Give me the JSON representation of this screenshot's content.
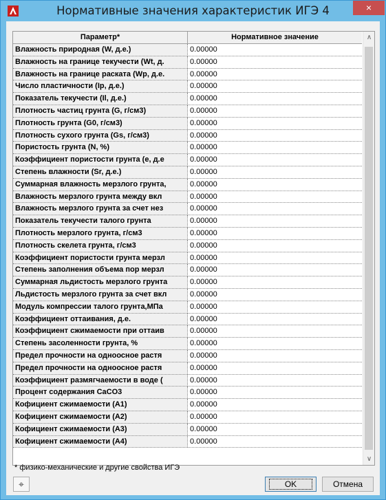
{
  "window": {
    "title": "Нормативные значения характеристик ИГЭ 4",
    "close_glyph": "×"
  },
  "grid": {
    "columns": [
      "Параметр*",
      "Нормативное значение"
    ],
    "rows": [
      {
        "param": "Влажность природная (W, д.е.)",
        "value": "0.00000"
      },
      {
        "param": "Влажность на границе текучести (Wt, д.",
        "value": "0.00000"
      },
      {
        "param": "Влажность на границе раската (Wp, д.е.",
        "value": "0.00000"
      },
      {
        "param": "Число пластичности (Ip, д.е.)",
        "value": "0.00000"
      },
      {
        "param": "Показатель текучести (Il, д.е.)",
        "value": "0.00000"
      },
      {
        "param": "Плотность частиц грунта (G, г/см3)",
        "value": "0.00000"
      },
      {
        "param": "Плотность грунта (G0, г/см3)",
        "value": "0.00000"
      },
      {
        "param": "Плотность сухого грунта (Gs, г/см3)",
        "value": "0.00000"
      },
      {
        "param": "Пористость грунта (N, %)",
        "value": "0.00000"
      },
      {
        "param": "Коэффициент пористости грунта (e, д.е",
        "value": "0.00000"
      },
      {
        "param": "Степень влажности (Sr, д.е.)",
        "value": "0.00000"
      },
      {
        "param": "Суммарная влажность мерзлого грунта,",
        "value": "0.00000"
      },
      {
        "param": "Влажность мерзлого грунта между вкл",
        "value": "0.00000"
      },
      {
        "param": "Влажность мерзлого грунта за счет нез",
        "value": "0.00000"
      },
      {
        "param": "Показатель текучести талого грунта",
        "value": "0.00000"
      },
      {
        "param": "Плотность мерзлого грунта, г/см3",
        "value": "0.00000"
      },
      {
        "param": "Плотность скелета грунта, г/см3",
        "value": "0.00000"
      },
      {
        "param": "Коэффициент пористости грунта мерзл",
        "value": "0.00000"
      },
      {
        "param": "Степень заполнения объема пор мерзл",
        "value": "0.00000"
      },
      {
        "param": "Суммарная льдистость мерзлого грунта",
        "value": "0.00000"
      },
      {
        "param": "Льдистость мерзлого грунта за счет вкл",
        "value": "0.00000"
      },
      {
        "param": "Модуль компрессии талого грунта,МПа",
        "value": "0.00000"
      },
      {
        "param": "Коэффициент оттаивания, д.е.",
        "value": "0.00000"
      },
      {
        "param": "Коэффициент сжимаемости при оттаив",
        "value": "0.00000"
      },
      {
        "param": "Степень засоленности грунта, %",
        "value": "0.00000"
      },
      {
        "param": "Предел прочности на одноосное растя",
        "value": "0.00000"
      },
      {
        "param": "Предел прочности на одноосное растя",
        "value": "0.00000"
      },
      {
        "param": "Коэффициент размягчаемости в воде (",
        "value": "0.00000"
      },
      {
        "param": "Процент содержания CaCO3",
        "value": "0.00000"
      },
      {
        "param": "Кофициент сжимаемости (A1)",
        "value": "0.00000"
      },
      {
        "param": "Кофициент сжимаемости (A2)",
        "value": "0.00000"
      },
      {
        "param": "Кофициент сжимаемости (A3)",
        "value": "0.00000"
      },
      {
        "param": "Кофициент сжимаемости (A4)",
        "value": "0.00000"
      }
    ]
  },
  "footnote": "* физико-механические и другие свойства ИГЭ",
  "buttons": {
    "pin_glyph": "⌖",
    "ok": "OK",
    "cancel": "Отмена"
  },
  "scroll": {
    "up_glyph": "∧",
    "down_glyph": "∨"
  },
  "icons": {
    "app": "autocad-logo-icon"
  },
  "colors": {
    "titlebar": "#71bde6",
    "close": "#c74f4f",
    "client": "#f0f0f0"
  }
}
